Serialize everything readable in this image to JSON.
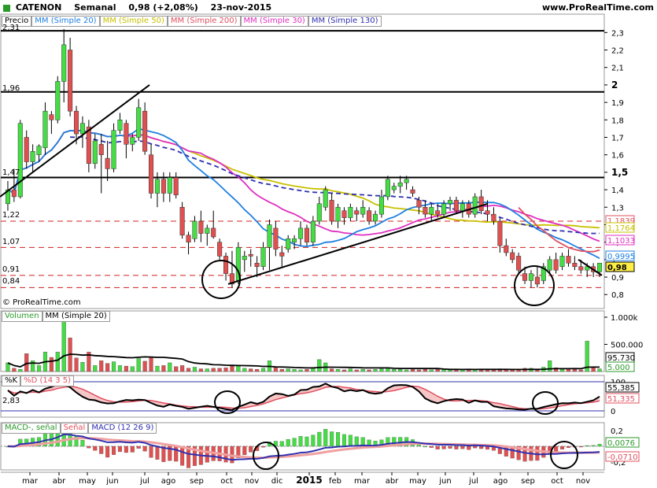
{
  "header": {
    "ticker": "CATENON",
    "period": "Semanal",
    "quote": "0,98 (+2,08%)",
    "date": "23-nov-2015",
    "source": "www.ProRealTime.com",
    "watermark": "© ProRealTime.com"
  },
  "price_panel": {
    "label": "Precio",
    "legend": [
      {
        "text": "MM (Simple 20)",
        "color": "#1e7fe0"
      },
      {
        "text": "MM (Simple 50)",
        "color": "#c8c000"
      },
      {
        "text": "MM (Simple 200)",
        "color": "#e05060"
      },
      {
        "text": "MM (Simple 30)",
        "color": "#e030c0"
      },
      {
        "text": "MM (Simple 130)",
        "color": "#3030b0"
      }
    ],
    "left_labels": [
      "2,31",
      "1,96",
      "1,47",
      "1,22",
      "1,07",
      "0,91",
      "0,84"
    ],
    "right_ticks": [
      "2,3",
      "2,2",
      "2,1",
      "2",
      "1,9",
      "1,8",
      "1,7",
      "1,6",
      "1,5",
      "1,4",
      "1,3",
      "1,2",
      "1,1",
      "1",
      "0,9",
      "0,8"
    ],
    "right_value_tags": [
      {
        "text": "1,1839",
        "color": "#e05060"
      },
      {
        "text": "1,1764",
        "color": "#c8c000"
      },
      {
        "text": "1,1033",
        "color": "#e030c0"
      },
      {
        "text": "0,9995",
        "color": "#1e7fe0"
      },
      {
        "text": "0,98",
        "color": "#000000"
      }
    ]
  },
  "volume_panel": {
    "legend": [
      {
        "text": "Volumen",
        "color": "#2a9a2a"
      },
      {
        "text": "MM (Simple 20)",
        "color": "#000000"
      }
    ],
    "right_ticks": [
      "1.000k",
      "500.000"
    ],
    "right_value_tags": [
      {
        "text": "95.730",
        "color": "#000000"
      },
      {
        "text": "5.000",
        "color": "#2a9a2a"
      }
    ]
  },
  "stoch_panel": {
    "legend": [
      {
        "text": "%K",
        "color": "#000000"
      },
      {
        "text": "%D (14 3 5)",
        "color": "#e05060"
      }
    ],
    "left_label": "2,83",
    "right_ticks": [
      "100",
      "0"
    ],
    "right_value_tags": [
      {
        "text": "55,385",
        "color": "#000000"
      },
      {
        "text": "51,335",
        "color": "#e05060"
      }
    ]
  },
  "macd_panel": {
    "legend": [
      {
        "text": "MACD-, señal",
        "color": "#2a9a2a"
      },
      {
        "text": "Señal",
        "color": "#e05060"
      },
      {
        "text": "MACD (12 26 9)",
        "color": "#3030b0"
      }
    ],
    "right_ticks": [
      "0,2",
      "-0,2"
    ],
    "right_value_tags": [
      {
        "text": "0,0076",
        "color": "#2a9a2a"
      },
      {
        "text": "-0,0710",
        "color": "#e05060"
      }
    ]
  },
  "x_axis": {
    "labels": [
      "mar",
      "abr",
      "may",
      "jun",
      "jul",
      "ago",
      "sep",
      "oct",
      "nov",
      "dic",
      "2015",
      "feb",
      "mar",
      "abr",
      "may",
      "jun",
      "jul",
      "ago",
      "sep",
      "oct",
      "nov"
    ]
  },
  "chart_data": {
    "type": "candlestick",
    "frequency": "weekly",
    "ylim": [
      0.72,
      2.36
    ],
    "horizontal_levels": [
      2.31,
      1.96,
      1.47
    ],
    "dashed_levels": [
      1.22,
      1.07,
      0.91,
      0.84
    ],
    "ohlc": [
      [
        1.32,
        1.45,
        1.28,
        1.4
      ],
      [
        1.4,
        1.52,
        1.33,
        1.36
      ],
      [
        1.36,
        1.8,
        1.35,
        1.78
      ],
      [
        1.7,
        1.74,
        1.52,
        1.56
      ],
      [
        1.56,
        1.66,
        1.5,
        1.62
      ],
      [
        1.6,
        1.66,
        1.56,
        1.65
      ],
      [
        1.64,
        1.9,
        1.6,
        1.85
      ],
      [
        1.83,
        1.85,
        1.72,
        1.8
      ],
      [
        1.8,
        2.05,
        1.78,
        2.02
      ],
      [
        2.02,
        2.32,
        1.9,
        2.23
      ],
      [
        2.2,
        2.27,
        1.82,
        1.85
      ],
      [
        1.85,
        1.88,
        1.66,
        1.72
      ],
      [
        1.72,
        1.82,
        1.64,
        1.78
      ],
      [
        1.76,
        1.8,
        1.5,
        1.55
      ],
      [
        1.55,
        1.72,
        1.52,
        1.68
      ],
      [
        1.66,
        1.72,
        1.38,
        1.6
      ],
      [
        1.58,
        1.68,
        1.45,
        1.52
      ],
      [
        1.52,
        1.78,
        1.5,
        1.74
      ],
      [
        1.74,
        1.84,
        1.72,
        1.8
      ],
      [
        1.78,
        1.8,
        1.58,
        1.66
      ],
      [
        1.66,
        1.72,
        1.62,
        1.7
      ],
      [
        1.7,
        1.92,
        1.68,
        1.87
      ],
      [
        1.85,
        1.9,
        1.6,
        1.62
      ],
      [
        1.6,
        1.66,
        1.35,
        1.38
      ],
      [
        1.38,
        1.5,
        1.3,
        1.46
      ],
      [
        1.46,
        1.5,
        1.33,
        1.38
      ],
      [
        1.38,
        1.5,
        1.33,
        1.47
      ],
      [
        1.47,
        1.5,
        1.35,
        1.37
      ],
      [
        1.3,
        1.33,
        1.12,
        1.14
      ],
      [
        1.14,
        1.16,
        1.03,
        1.1
      ],
      [
        1.12,
        1.25,
        1.1,
        1.22
      ],
      [
        1.22,
        1.28,
        1.1,
        1.15
      ],
      [
        1.15,
        1.2,
        1.08,
        1.18
      ],
      [
        1.18,
        1.28,
        1.12,
        1.13
      ],
      [
        1.1,
        1.12,
        1.0,
        1.02
      ],
      [
        1.02,
        1.04,
        0.88,
        0.92
      ],
      [
        0.92,
        1.05,
        0.84,
        0.86
      ],
      [
        0.88,
        1.1,
        0.86,
        1.07
      ],
      [
        1.0,
        1.05,
        0.93,
        1.02
      ],
      [
        1.03,
        1.06,
        0.96,
        1.02
      ],
      [
        0.98,
        1.02,
        0.9,
        0.96
      ],
      [
        0.96,
        1.1,
        0.94,
        1.07
      ],
      [
        1.07,
        1.23,
        0.94,
        1.2
      ],
      [
        1.18,
        1.22,
        1.02,
        1.06
      ],
      [
        1.04,
        1.08,
        0.96,
        1.02
      ],
      [
        1.06,
        1.14,
        1.04,
        1.12
      ],
      [
        1.1,
        1.14,
        1.06,
        1.12
      ],
      [
        1.12,
        1.22,
        1.08,
        1.18
      ],
      [
        1.18,
        1.2,
        1.08,
        1.1
      ],
      [
        1.1,
        1.25,
        1.08,
        1.22
      ],
      [
        1.22,
        1.36,
        1.2,
        1.32
      ],
      [
        1.3,
        1.42,
        1.28,
        1.4
      ],
      [
        1.34,
        1.38,
        1.2,
        1.22
      ],
      [
        1.22,
        1.32,
        1.18,
        1.3
      ],
      [
        1.28,
        1.3,
        1.2,
        1.24
      ],
      [
        1.24,
        1.32,
        1.22,
        1.3
      ],
      [
        1.28,
        1.3,
        1.22,
        1.26
      ],
      [
        1.26,
        1.34,
        1.24,
        1.3
      ],
      [
        1.28,
        1.3,
        1.2,
        1.22
      ],
      [
        1.22,
        1.28,
        1.2,
        1.26
      ],
      [
        1.26,
        1.4,
        1.24,
        1.36
      ],
      [
        1.36,
        1.48,
        1.34,
        1.46
      ],
      [
        1.4,
        1.44,
        1.38,
        1.42
      ],
      [
        1.42,
        1.48,
        1.38,
        1.44
      ],
      [
        1.44,
        1.48,
        1.4,
        1.46
      ],
      [
        1.4,
        1.42,
        1.36,
        1.38
      ],
      [
        1.34,
        1.36,
        1.26,
        1.3
      ],
      [
        1.3,
        1.34,
        1.24,
        1.26
      ],
      [
        1.26,
        1.32,
        1.22,
        1.3
      ],
      [
        1.28,
        1.32,
        1.24,
        1.26
      ],
      [
        1.26,
        1.34,
        1.24,
        1.32
      ],
      [
        1.32,
        1.36,
        1.28,
        1.34
      ],
      [
        1.34,
        1.36,
        1.26,
        1.28
      ],
      [
        1.28,
        1.34,
        1.24,
        1.32
      ],
      [
        1.32,
        1.34,
        1.24,
        1.26
      ],
      [
        1.26,
        1.38,
        1.24,
        1.36
      ],
      [
        1.36,
        1.4,
        1.26,
        1.28
      ],
      [
        1.28,
        1.34,
        1.22,
        1.26
      ],
      [
        1.26,
        1.3,
        1.2,
        1.22
      ],
      [
        1.22,
        1.24,
        1.04,
        1.08
      ],
      [
        1.08,
        1.12,
        1.02,
        1.04
      ],
      [
        1.04,
        1.06,
        0.98,
        1.0
      ],
      [
        1.02,
        1.04,
        0.92,
        0.94
      ],
      [
        0.92,
        0.96,
        0.86,
        0.88
      ],
      [
        0.88,
        0.94,
        0.84,
        0.92
      ],
      [
        0.9,
        0.96,
        0.84,
        0.86
      ],
      [
        0.88,
        0.98,
        0.86,
        0.96
      ],
      [
        0.94,
        1.02,
        0.92,
        1.0
      ],
      [
        1.0,
        1.04,
        0.92,
        0.94
      ],
      [
        0.96,
        1.04,
        0.94,
        1.02
      ],
      [
        1.02,
        1.06,
        0.96,
        0.98
      ],
      [
        0.98,
        1.02,
        0.94,
        0.96
      ],
      [
        0.96,
        1.0,
        0.92,
        0.94
      ],
      [
        0.94,
        0.98,
        0.9,
        0.96
      ],
      [
        0.96,
        0.98,
        0.9,
        0.93
      ],
      [
        0.93,
        0.98,
        0.9,
        0.98
      ]
    ],
    "volume": [
      160,
      60,
      40,
      330,
      200,
      110,
      360,
      260,
      360,
      1000,
      620,
      250,
      170,
      360,
      110,
      200,
      150,
      180,
      110,
      100,
      90,
      240,
      190,
      260,
      100,
      110,
      160,
      90,
      110,
      60,
      80,
      50,
      50,
      60,
      60,
      70,
      100,
      120,
      60,
      50,
      40,
      60,
      200,
      80,
      40,
      50,
      40,
      30,
      40,
      60,
      220,
      160,
      50,
      40,
      30,
      50,
      30,
      40,
      30,
      40,
      50,
      60,
      40,
      40,
      30,
      40,
      30,
      40,
      30,
      40,
      40,
      30,
      40,
      30,
      40,
      40,
      40,
      40,
      30,
      50,
      40,
      30,
      40,
      60,
      60,
      40,
      80,
      200,
      70,
      40,
      50,
      40,
      30,
      560,
      70,
      50
    ]
  }
}
